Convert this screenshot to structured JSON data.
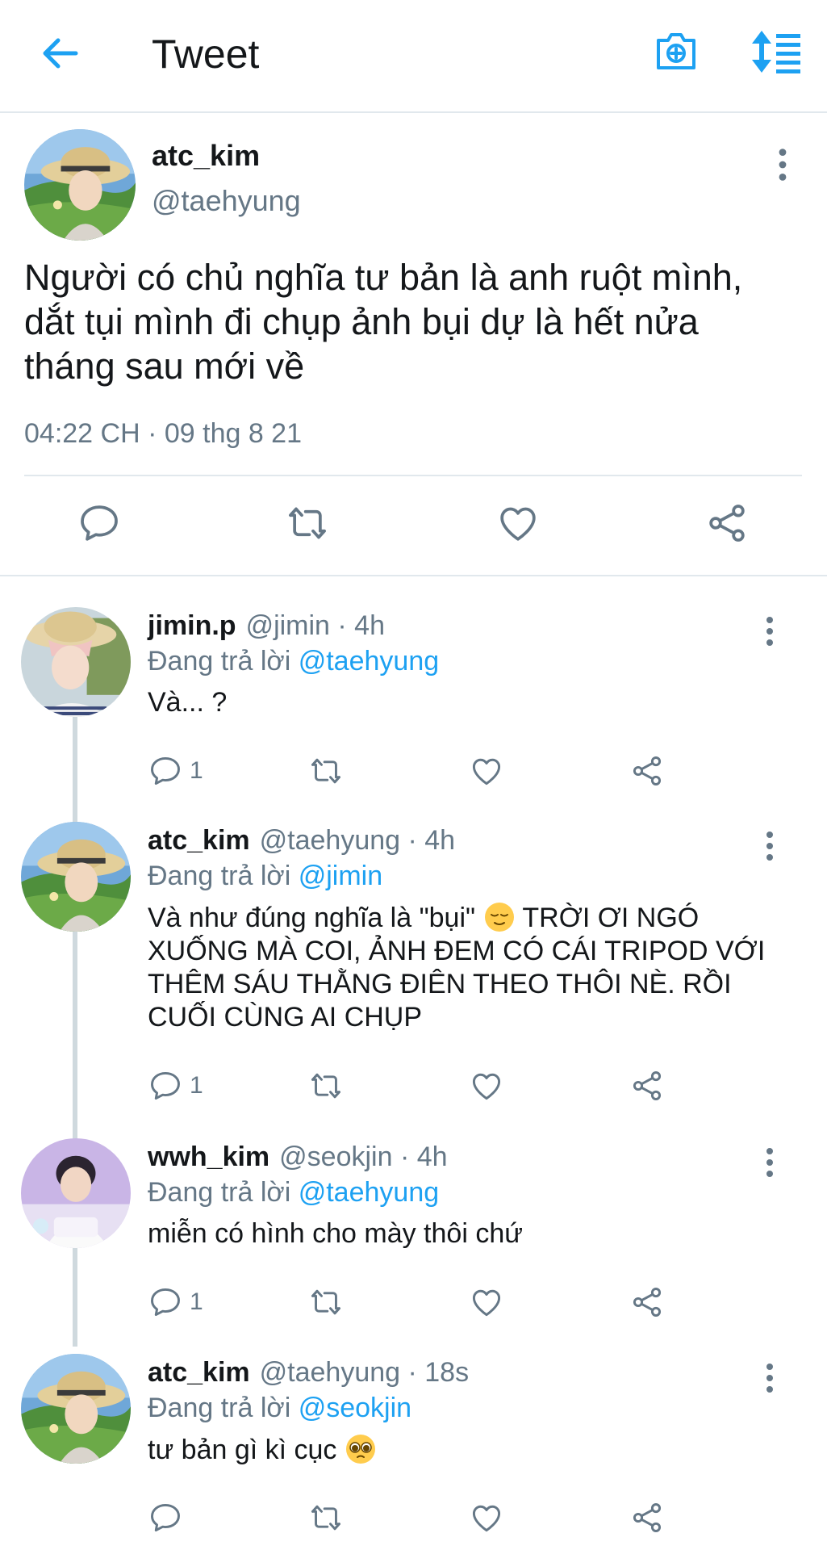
{
  "header": {
    "title": "Tweet",
    "back_icon": "arrow-left-icon",
    "camera_icon": "camera-plus-icon",
    "sort_icon": "sort-icon"
  },
  "colors": {
    "accent": "#1da1f2",
    "text": "#14171a",
    "muted": "#657786",
    "border": "#e1e8ed"
  },
  "main_tweet": {
    "name": "atc_kim",
    "handle": "@taehyung",
    "text": "Người có chủ nghĩa tư bản là anh ruột mình, dắt tụi mình đi chụp ảnh bụi dự là hết nửa tháng sau mới về",
    "timestamp": "04:22 CH · 09 thg 8 21"
  },
  "replies": [
    {
      "name": "jimin.p",
      "meta": "@jimin · 4h",
      "reply_prefix": "Đang trả lời",
      "reply_to": "@taehyung",
      "text": "Và... ?",
      "reply_count": "1"
    },
    {
      "name": "atc_kim",
      "meta": "@taehyung · 4h",
      "reply_prefix": "Đang trả lời",
      "reply_to": "@jimin",
      "text_before_emoji": "Và như đúng nghĩa là \"bụi\"",
      "text_after_emoji": "TRỜI ƠI NGÓ XUỐNG MÀ COI, ẢNH ĐEM CÓ CÁI TRIPOD VỚI THÊM SÁU THẰNG ĐIÊN THEO THÔI NÈ. RỒI CUỐI CÙNG AI CHỤP",
      "emoji": "relieved-face-emoji",
      "reply_count": "1"
    },
    {
      "name": "wwh_kim",
      "meta": "@seokjin · 4h",
      "reply_prefix": "Đang trả lời",
      "reply_to": "@taehyung",
      "text": "miễn có hình cho mày thôi chứ",
      "reply_count": "1"
    },
    {
      "name": "atc_kim",
      "meta": "@taehyung · 18s",
      "reply_prefix": "Đang trả lời",
      "reply_to": "@seokjin",
      "text": "tư bản gì kì cục",
      "emoji": "pleading-face-emoji",
      "reply_count": ""
    }
  ]
}
